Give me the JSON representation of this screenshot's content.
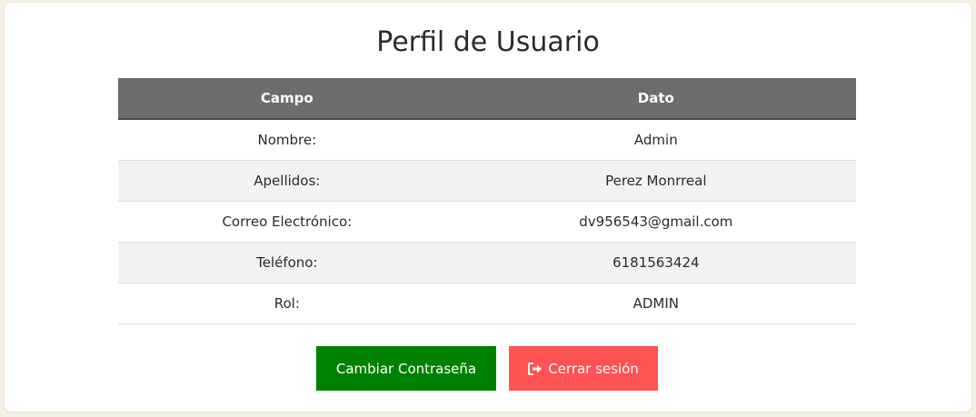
{
  "page_title": "Perfil de Usuario",
  "table": {
    "headers": [
      "Campo",
      "Dato"
    ],
    "rows": [
      {
        "campo": "Nombre:",
        "dato": "Admin"
      },
      {
        "campo": "Apellidos:",
        "dato": "Perez Monrreal"
      },
      {
        "campo": "Correo Electrónico:",
        "dato": "dv956543@gmail.com"
      },
      {
        "campo": "Teléfono:",
        "dato": "6181563424"
      },
      {
        "campo": "Rol:",
        "dato": "ADMIN"
      }
    ]
  },
  "actions": {
    "change_password_label": "Cambiar Contraseña",
    "logout_label": "Cerrar sesión",
    "logout_icon": "sign-out-icon"
  },
  "colors": {
    "background": "#f4efe3",
    "header_bg": "#6d6d6d",
    "change_password_bg": "#008000",
    "logout_bg": "#ff5252"
  }
}
